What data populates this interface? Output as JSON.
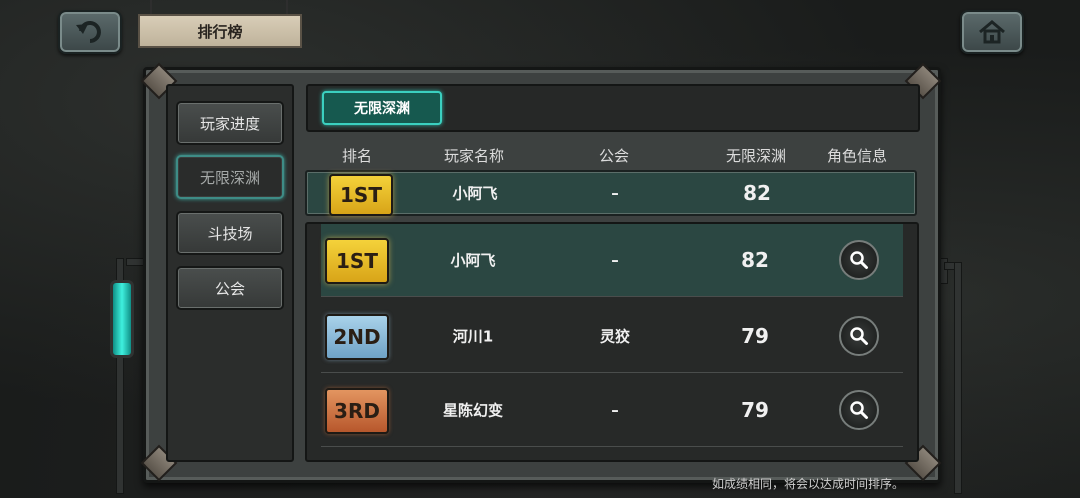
{
  "header": {
    "title": "排行榜",
    "back_icon": "back-arrow-icon",
    "home_icon": "home-icon"
  },
  "sidebar": {
    "items": [
      {
        "label": "玩家进度",
        "active": false
      },
      {
        "label": "无限深渊",
        "active": true
      },
      {
        "label": "斗技场",
        "active": false
      },
      {
        "label": "公会",
        "active": false
      }
    ]
  },
  "tabs": {
    "active_label": "无限深渊"
  },
  "table": {
    "headers": {
      "rank": "排名",
      "name": "玩家名称",
      "guild": "公会",
      "score": "无限深渊",
      "info": "角色信息"
    },
    "my_row": {
      "rank": "1ST",
      "name": "小阿飞",
      "guild": "–",
      "score": "82"
    },
    "rows": [
      {
        "rank": "1ST",
        "name": "小阿飞",
        "guild": "–",
        "score": "82",
        "highlight": true
      },
      {
        "rank": "2ND",
        "name": "河川1",
        "guild": "灵狡",
        "score": "79",
        "highlight": false
      },
      {
        "rank": "3RD",
        "name": "星陈幻变",
        "guild": "–",
        "score": "79",
        "highlight": false
      }
    ]
  },
  "footer": {
    "note": "如成绩相同，将会以达成时间排序。"
  },
  "colors": {
    "accent": "#3bd0c0",
    "gold": "#e2b72a",
    "silver": "#8fbcdc",
    "bronze": "#c8693a"
  }
}
